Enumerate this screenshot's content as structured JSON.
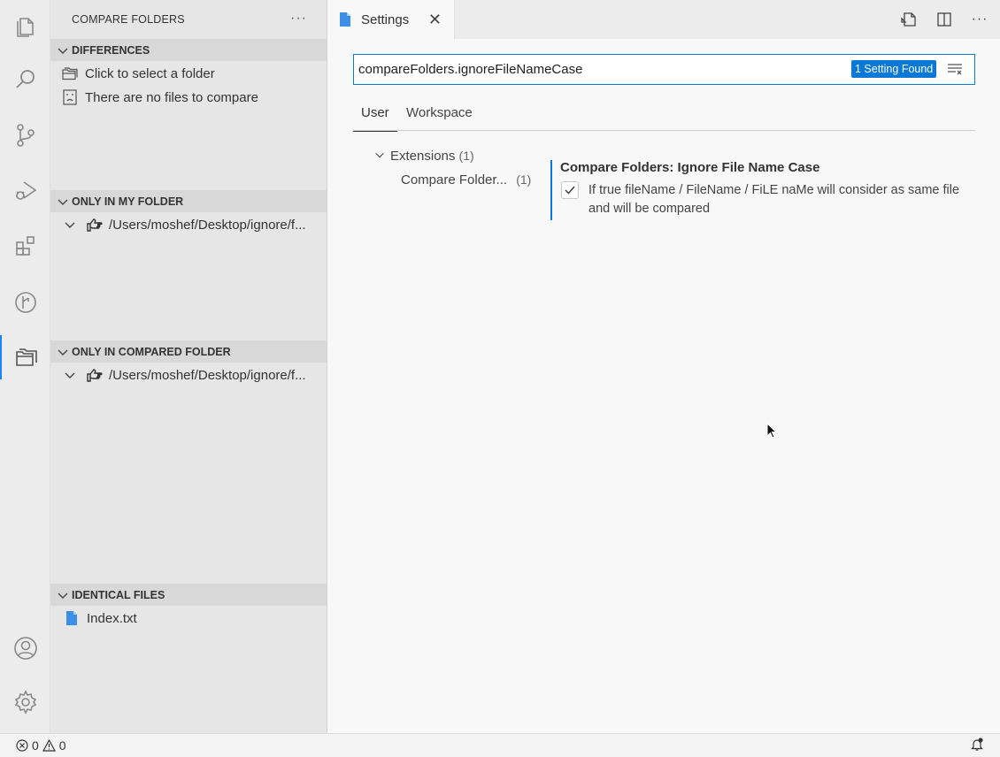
{
  "sidebar": {
    "title": "COMPARE FOLDERS",
    "more": "···",
    "sections": {
      "differences": {
        "title": "DIFFERENCES",
        "rows": [
          "Click to select a folder",
          "There are no files to compare"
        ]
      },
      "only_mine": {
        "title": "ONLY IN MY FOLDER",
        "path": "/Users/moshef/Desktop/ignore/f..."
      },
      "only_compared": {
        "title": "ONLY IN COMPARED FOLDER",
        "path": "/Users/moshef/Desktop/ignore/f..."
      },
      "identical": {
        "title": "IDENTICAL FILES",
        "file": "Index.txt"
      }
    }
  },
  "editor": {
    "tab_label": "Settings",
    "tab_close": "✕",
    "actions_more": "···",
    "search": {
      "value": "compareFolders.ignoreFileNameCase",
      "badge": "1 Setting Found"
    },
    "scope_tabs": [
      "User",
      "Workspace"
    ],
    "toc": {
      "group": "Extensions",
      "group_count": "(1)",
      "item": "Compare Folder...",
      "item_count": "(1)"
    },
    "setting": {
      "title_prefix": "Compare Folders: ",
      "title": "Ignore File Name Case",
      "checked": true,
      "description": "If true fileName / FileName / FiLE naMe will consider as same file and will be compared"
    }
  },
  "status": {
    "errors": "0",
    "warnings": "0"
  },
  "colors": {
    "accent": "#0a78d7",
    "activity_bar": "#ececec",
    "sidebar": "#e6e6e6"
  }
}
